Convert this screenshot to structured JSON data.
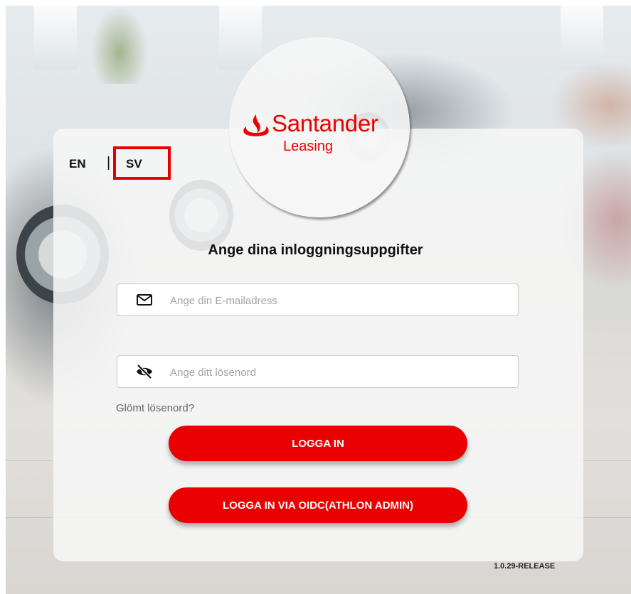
{
  "brand": {
    "name": "Santander",
    "subtitle": "Leasing",
    "color": "#ec0000",
    "logo_icon": "santander-flame-icon"
  },
  "language": {
    "options": [
      "EN",
      "SV"
    ],
    "separator": "|",
    "selected": "SV",
    "highlight_color": "#e60000"
  },
  "login": {
    "heading": "Ange dina inloggningsuppgifter",
    "email": {
      "placeholder": "Ange din E-mailadress",
      "value": "",
      "icon": "envelope-icon"
    },
    "password": {
      "placeholder": "Ange ditt lösenord",
      "value": "",
      "icon": "eye-slash-icon"
    },
    "forgot_password": "Glömt lösenord?",
    "submit_label": "LOGGA IN",
    "oidc_label": "LOGGA IN VIA OIDC(ATHLON ADMIN)",
    "button_color": "#ea0000"
  },
  "footer": {
    "version": "1.0.29-RELEASE"
  }
}
